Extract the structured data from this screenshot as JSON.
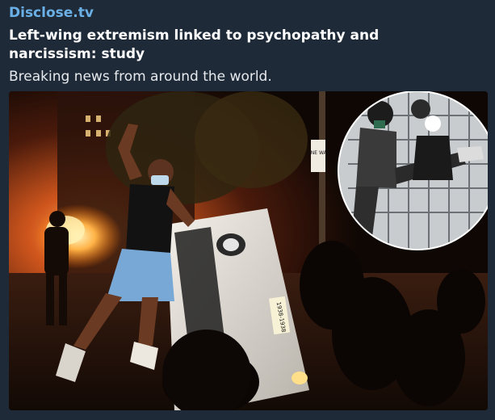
{
  "post": {
    "source": "Disclose.tv",
    "title": "Left-wing extremism linked to psychopathy and narcissism: study",
    "description": "Breaking news from around the world."
  },
  "photo": {
    "sign_text": "ONE WAY",
    "plate_text": "1938-1938"
  },
  "colors": {
    "background": "#1f2a38",
    "source_link": "#6ab0e6",
    "title": "#ffffff",
    "description": "#e6e9ed"
  }
}
